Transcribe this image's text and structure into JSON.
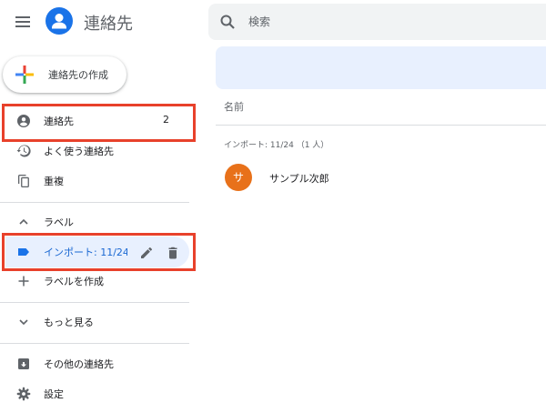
{
  "app": {
    "title": "連絡先"
  },
  "sidebar": {
    "create_label": "連絡先の作成",
    "items": {
      "contacts": {
        "label": "連絡先",
        "count": "2"
      },
      "frequent": {
        "label": "よく使う連絡先"
      },
      "duplicates": {
        "label": "重複"
      }
    },
    "labels_header": "ラベル",
    "label_item": {
      "label": "インポート: 11/24"
    },
    "create_label_item": "ラベルを作成",
    "more": "もっと見る",
    "other_contacts": "その他の連絡先",
    "settings": "設定"
  },
  "search": {
    "placeholder": "検索"
  },
  "main": {
    "column_header": "名前",
    "group_header": "インポート: 11/24 （1 人）",
    "contacts": [
      {
        "initial": "サ",
        "name": "サンプル次郎"
      }
    ]
  },
  "colors": {
    "accent": "#1a73e8",
    "selected_bg": "#e8f0fe",
    "avatar": "#e8711a",
    "highlight": "#e8412b"
  }
}
